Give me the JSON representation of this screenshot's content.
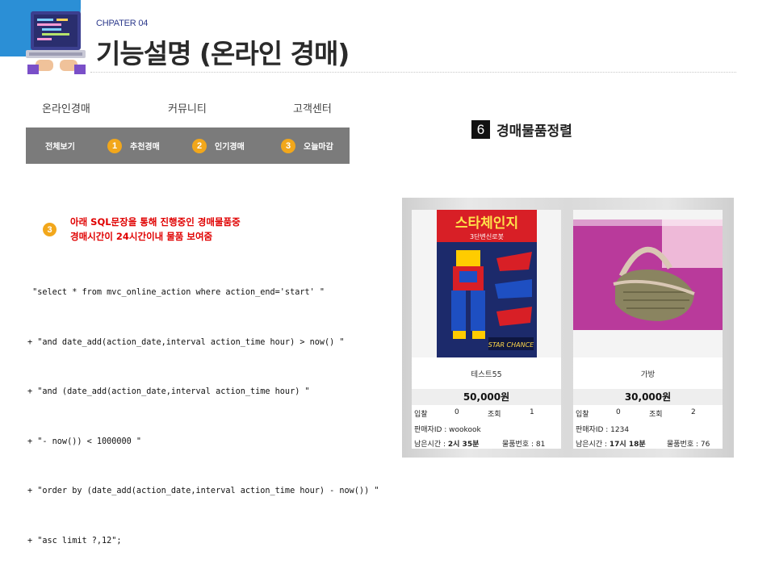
{
  "header": {
    "chapter": "CHPATER 04",
    "title": "기능설명 (온라인 경매)"
  },
  "topnav": [
    "온라인경매",
    "커뮤니티",
    "고객센터"
  ],
  "subnav": [
    {
      "label": "전체보기",
      "num": ""
    },
    {
      "label": "추천경매",
      "num": "1"
    },
    {
      "label": "인기경매",
      "num": "2"
    },
    {
      "label": "오늘마감",
      "num": "3"
    }
  ],
  "section": {
    "num": "6",
    "label": "경매물품정렬"
  },
  "note": {
    "num": "3",
    "line1": "아래 SQL문장을 통해 진행중인 경매물품중",
    "line2": "경매시간이 24시간이내 물품 보여줌"
  },
  "code": [
    " \"select * from mvc_online_action where action_end='start' \"",
    "+ \"and date_add(action_date,interval action_time hour) > now() \"",
    "+ \"and (date_add(action_date,interval action_time hour) \"",
    "+ \"- now()) < 1000000 \"",
    "+ \"order by (date_add(action_date,interval action_time hour) - now()) \"",
    "+ \"asc limit ?,12\";"
  ],
  "cards": [
    {
      "image": "toy-robot-box-image",
      "box_text": "스타체인지",
      "box_sub": "3단변신로봇",
      "box_brand": "STAR CHANCE",
      "name": "테스트55",
      "price": "50,000원",
      "bid_label": "입찰",
      "bid": "0",
      "view_label": "조회",
      "views": "1",
      "seller": "판매자ID : wookook",
      "remain_label": "남은시간 : ",
      "remain": "2시 35분",
      "itemno": "물품번호 : 81"
    },
    {
      "image": "handbag-image",
      "name": "가방",
      "price": "30,000원",
      "bid_label": "입찰",
      "bid": "0",
      "view_label": "조회",
      "views": "2",
      "seller": "판매자ID : 1234",
      "remain_label": "남은시간 : ",
      "remain": "17시 18분",
      "itemno": "물품번호 : 76"
    }
  ],
  "colors": {
    "accent_blue": "#2b8fd6",
    "badge_orange": "#f2a71b",
    "note_red": "#e00000",
    "subnav_gray": "#7b7b7b"
  }
}
